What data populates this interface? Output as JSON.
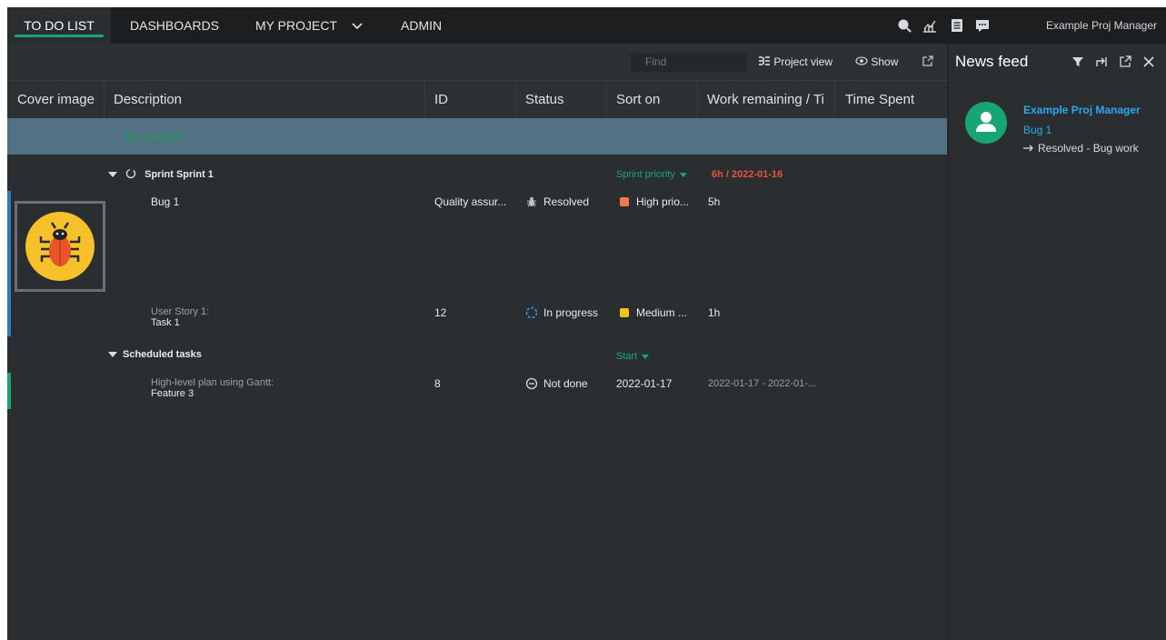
{
  "nav": {
    "tabs": [
      {
        "label": "TO DO LIST",
        "active": true
      },
      {
        "label": "DASHBOARDS"
      },
      {
        "label": "MY PROJECT"
      },
      {
        "label": "ADMIN"
      }
    ],
    "user": "Example Proj Manager"
  },
  "toolbar": {
    "find_placeholder": "Find",
    "project_view": "Project view",
    "show": "Show"
  },
  "table": {
    "columns": [
      "Cover image",
      "Description",
      "ID",
      "Status",
      "Sort on",
      "Work remaining / Ti",
      "Time Spent"
    ],
    "project": "My project",
    "groups": [
      {
        "title": "Sprint Sprint 1",
        "sort_label": "Sprint priority",
        "summary": "6h / 2022-01-16",
        "rows": [
          {
            "description": "Bug 1",
            "id": "Quality assur...",
            "status": "Resolved",
            "sort": "High prio...",
            "work": "5h"
          },
          {
            "parent": "User Story 1:",
            "description": "Task 1",
            "id": "12",
            "status": "In progress",
            "sort": "Medium ...",
            "work": "1h"
          }
        ]
      },
      {
        "title": "Scheduled tasks",
        "sort_label": "Start",
        "rows": [
          {
            "parent": "High-level plan using Gantt:",
            "description": "Feature 3",
            "id": "8",
            "status": "Not done",
            "sort": "2022-01-17",
            "work": "2022-01-17 - 2022-01-..."
          }
        ]
      }
    ]
  },
  "feed": {
    "title": "News feed",
    "author": "Example Proj Manager",
    "item": "Bug 1",
    "change": "Resolved - Bug work"
  },
  "colors": {
    "accent": "#17a673",
    "link": "#2aa8f2",
    "high_priority": "#f07a4a",
    "medium_priority": "#f2c319",
    "overdue": "#e8543a",
    "project_row": "#537184"
  },
  "icons": [
    "search-icon",
    "chart-icon",
    "document-icon",
    "chat-icon",
    "filter-icon",
    "pin-icon",
    "popout-icon",
    "close-icon",
    "eye-icon",
    "bug-icon",
    "user-icon"
  ]
}
